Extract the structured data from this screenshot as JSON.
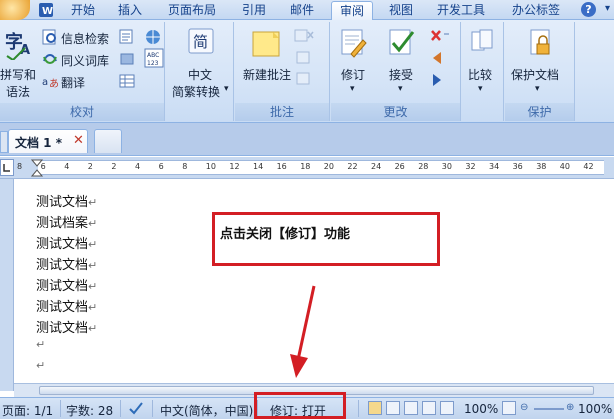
{
  "ribbon_tabs": [
    "开始",
    "插入",
    "页面布局",
    "引用",
    "邮件",
    "审阅",
    "视图",
    "开发工具",
    "办公标签"
  ],
  "active_tab": "审阅",
  "groups": {
    "proofing": {
      "label": "校对",
      "spelling_label_1": "拼写和",
      "spelling_label_2": "语法",
      "research": "信息检索",
      "thesaurus": "同义词库",
      "translate": "翻译"
    },
    "chinese": {
      "label_1": "中文",
      "label_2": "简繁转换",
      "button_char": "简"
    },
    "comments": {
      "label": "批注",
      "new_comment": "新建批注"
    },
    "tracking": {
      "label": "更改",
      "track_changes": "修订",
      "accept": "接受"
    },
    "compare": {
      "compare": "比较"
    },
    "protect": {
      "label": "保护",
      "protect_doc": "保护文档"
    }
  },
  "abc_badge": "ABC\n123",
  "doc_tab": {
    "title": "文档 1 *",
    "close": "✕",
    "left_stub": "图"
  },
  "ruler_ticks": [
    "8",
    "6",
    "4",
    "2",
    "2",
    "4",
    "6",
    "8",
    "10",
    "12",
    "14",
    "16",
    "18",
    "20",
    "22",
    "24",
    "26",
    "28",
    "30",
    "32",
    "34",
    "36",
    "38",
    "40",
    "42"
  ],
  "doc_lines": [
    "测试文档",
    "测试档案",
    "测试文档",
    "测试文档",
    "测试文档",
    "测试文档",
    "测试文档"
  ],
  "para_mark": "↵",
  "callout_text": "点击关闭【修订】功能",
  "status": {
    "page": "页面: 1/1",
    "words": "字数: 28",
    "language": "中文(简体，中国)",
    "track": "修订: 打开",
    "zoom_1": "100%",
    "zoom_2": "100%"
  },
  "colors": {
    "annotation_red": "#d31e24",
    "ribbon_blue": "#c9dcf4"
  }
}
